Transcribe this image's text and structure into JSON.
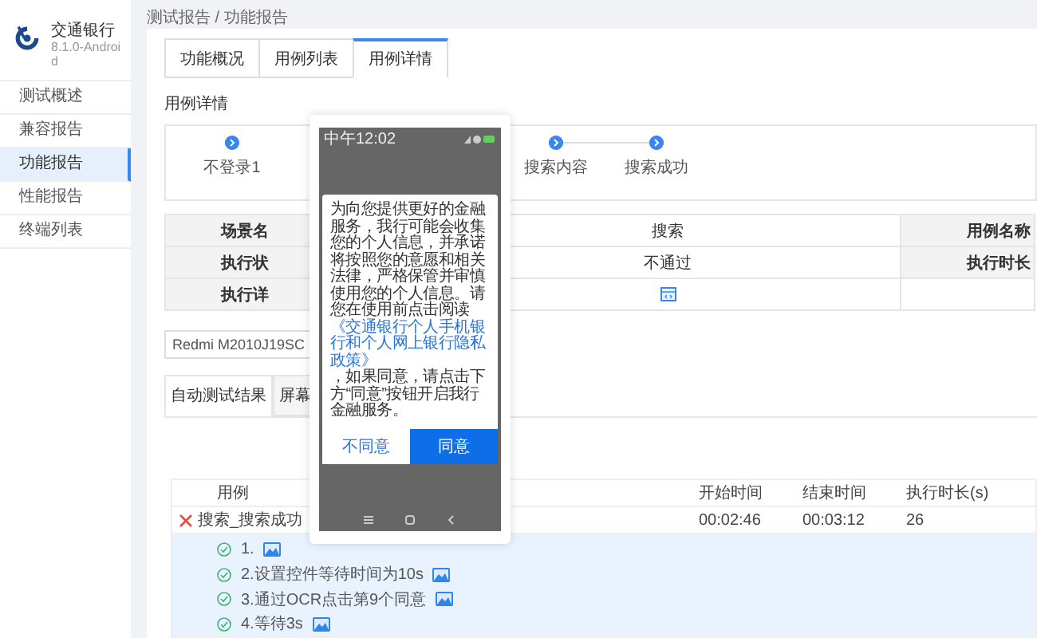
{
  "sidebar": {
    "app_name": "交通银行",
    "version": "8.1.0-Android",
    "items": [
      {
        "label": "测试概述",
        "selected": false
      },
      {
        "label": "兼容报告",
        "selected": false
      },
      {
        "label": "功能报告",
        "selected": true
      },
      {
        "label": "性能报告",
        "selected": false
      },
      {
        "label": "终端列表",
        "selected": false
      }
    ]
  },
  "breadcrumb": "测试报告 / 功能报告",
  "tabs": [
    {
      "label": "功能概况",
      "selected": false
    },
    {
      "label": "用例列表",
      "selected": false
    },
    {
      "label": "用例详情",
      "selected": true
    }
  ],
  "section_title": "用例详情",
  "steps": [
    {
      "label": "不登录1"
    },
    {
      "label": "搜索内容"
    },
    {
      "label": "搜索成功"
    }
  ],
  "info_table": {
    "rows": [
      {
        "label": "场景名",
        "value": "搜索",
        "label_2": "用例名称"
      },
      {
        "label": "执行状",
        "value": "不通过",
        "label_2": "执行时长"
      },
      {
        "label": "执行详"
      }
    ]
  },
  "device_select": {
    "value": "Redmi M2010J19SC"
  },
  "result_tabs": [
    {
      "label": "自动测试结果",
      "selected": true
    },
    {
      "label": "屏幕",
      "selected": false
    }
  ],
  "results": {
    "columns": [
      "用例",
      "开始时间",
      "结束时间",
      "执行时长(s)"
    ],
    "rows": [
      {
        "name": "搜索_搜索成功",
        "passed": false,
        "start": "00:02:46",
        "end": "00:03:12",
        "duration": "26",
        "steps": [
          {
            "label": "1.",
            "passed": true
          },
          {
            "label": "2.设置控件等待时间为10s",
            "passed": true
          },
          {
            "label": "3.通过OCR点击第9个同意",
            "passed": true
          },
          {
            "label": "4.等待3s",
            "passed": true
          }
        ]
      }
    ]
  },
  "screenshot_popup": {
    "status_time": "中午12:02",
    "dialog": {
      "text_before": "为向您提供更好的金融服务，我行可能会收集您的个人信息，并承诺将按照您的意愿和相关法律，严格保管并审慎使用您的个人信息。请您在使用前点击阅读",
      "link": "《交通银行个人手机银行和个人网上银行隐私政策》",
      "text_after": "，如果同意，请点击下方“同意”按钮开启我行金融服务。",
      "buttons": [
        "不同意",
        "同意"
      ]
    }
  }
}
